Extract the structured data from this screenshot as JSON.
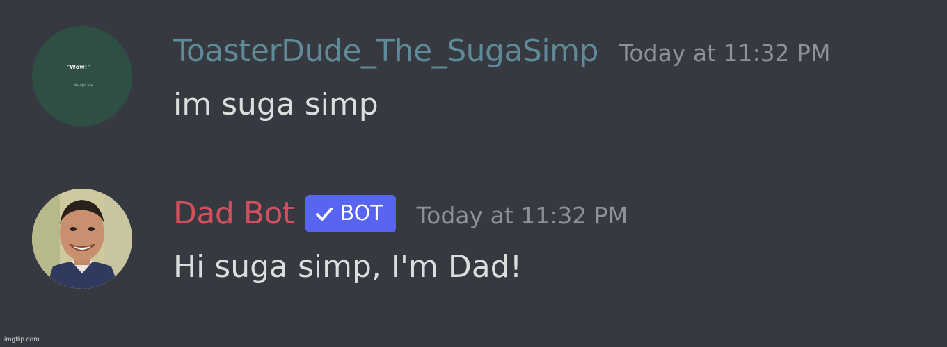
{
  "messages": [
    {
      "username": "ToasterDude_The_SugaSimp",
      "timestamp": "Today at 11:32 PM",
      "content": "im suga simp",
      "avatar": {
        "quote": "\"Wow!\"",
        "attribution": "~ You right now",
        "bg_color": "#2f4f44"
      },
      "name_color": "#5f8a98"
    },
    {
      "username": "Dad Bot",
      "bot_tag": "BOT",
      "timestamp": "Today at 11:32 PM",
      "content": "Hi suga simp, I'm Dad!",
      "name_color": "#d0505e",
      "tag_color": "#5865f2"
    }
  ],
  "watermark": "imgflip.com"
}
